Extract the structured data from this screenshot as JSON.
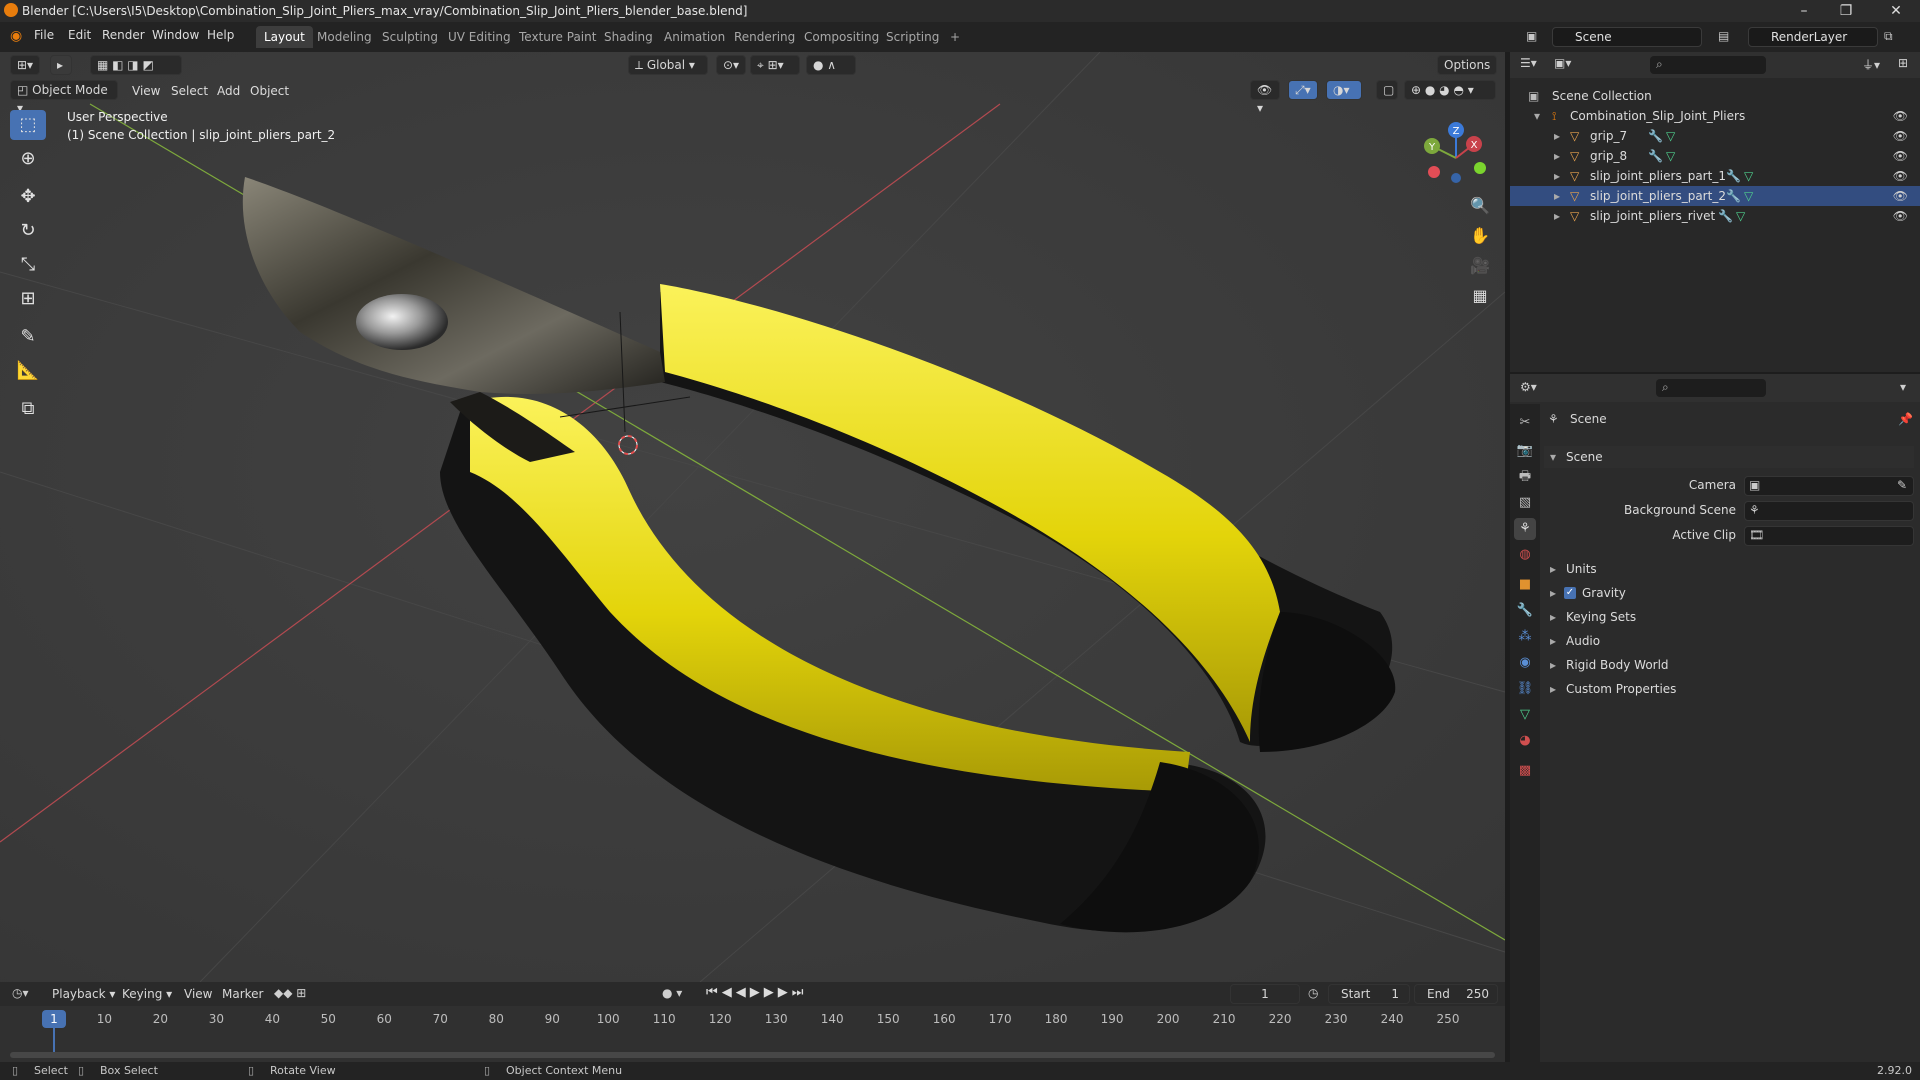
{
  "window": {
    "title": "Blender [C:\\Users\\I5\\Desktop\\Combination_Slip_Joint_Pliers_max_vray/Combination_Slip_Joint_Pliers_blender_base.blend]"
  },
  "menubar": {
    "items": [
      "File",
      "Edit",
      "Render",
      "Window",
      "Help"
    ]
  },
  "workspaces": {
    "tabs": [
      "Layout",
      "Modeling",
      "Sculpting",
      "UV Editing",
      "Texture Paint",
      "Shading",
      "Animation",
      "Rendering",
      "Compositing",
      "Scripting"
    ],
    "active": "Layout",
    "add_label": "+"
  },
  "scene": {
    "name": "Scene",
    "view_layer": "RenderLayer"
  },
  "viewport": {
    "mode": "Object Mode",
    "menus": [
      "View",
      "Select",
      "Add",
      "Object"
    ],
    "transform_orientation": "Global",
    "options_label": "Options",
    "overlay_line1": "User Perspective",
    "overlay_line2": "(1) Scene Collection | slip_joint_pliers_part_2",
    "gizmo_labels": {
      "z": "Z",
      "y": "Y",
      "x": "X"
    }
  },
  "outliner": {
    "root": "Scene Collection",
    "collection": "Combination_Slip_Joint_Pliers",
    "objects": [
      "grip_7",
      "grip_8",
      "slip_joint_pliers_part_1",
      "slip_joint_pliers_part_2",
      "slip_joint_pliers_rivet"
    ]
  },
  "properties": {
    "context": "Scene",
    "panel_title": "Scene",
    "fields": {
      "camera_label": "Camera",
      "background_scene_label": "Background Scene",
      "active_clip_label": "Active Clip"
    },
    "subpanels": [
      "Units",
      "Gravity",
      "Keying Sets",
      "Audio",
      "Rigid Body World",
      "Custom Properties"
    ],
    "gravity_checked": true
  },
  "timeline": {
    "menus": [
      "Playback",
      "Keying",
      "View",
      "Marker"
    ],
    "current_frame": "1",
    "start_label": "Start",
    "start": "1",
    "end_label": "End",
    "end": "250",
    "ticks": [
      "1",
      "10",
      "20",
      "30",
      "40",
      "50",
      "60",
      "70",
      "80",
      "90",
      "100",
      "110",
      "120",
      "130",
      "140",
      "150",
      "160",
      "170",
      "180",
      "190",
      "200",
      "210",
      "220",
      "230",
      "240",
      "250"
    ]
  },
  "statusbar": {
    "select": "Select",
    "box_select": "Box Select",
    "rotate_view": "Rotate View",
    "context_menu": "Object Context Menu",
    "version": "2.92.0"
  },
  "colors": {
    "accent": "#4772b3",
    "axis_x": "#c8424b",
    "axis_y": "#7da83c",
    "handle_yellow": "#e6d90f",
    "handle_black": "#161616"
  }
}
